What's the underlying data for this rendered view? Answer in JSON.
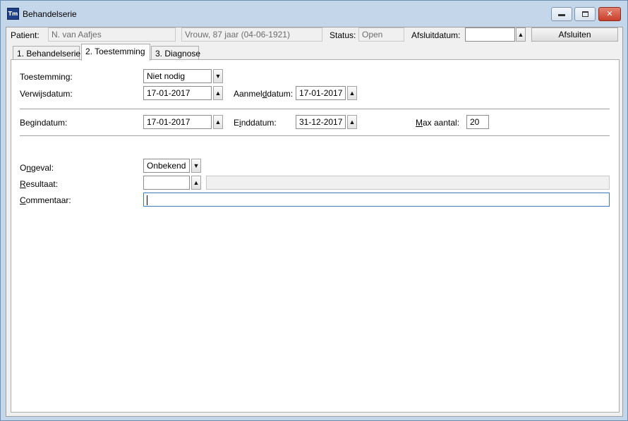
{
  "window": {
    "title": "Behandelserie",
    "app_icon_label": "Tm"
  },
  "header": {
    "patient_label": "Patient:",
    "patient_name": "N. van Aafjes",
    "patient_info": "Vrouw, 87 jaar (04-06-1921)",
    "status_label": "Status:",
    "status_value": "Open",
    "afsluitdatum_label": "Afsluitdatum:",
    "afsluitdatum_value": "",
    "afsluiten_button": "Afsluiten"
  },
  "tabs": [
    {
      "label": "1. Behandelserie",
      "active": false
    },
    {
      "label": "2. Toestemming",
      "active": true
    },
    {
      "label": "3. Diagnose",
      "active": false
    }
  ],
  "form": {
    "toestemming_label": "Toestemming:",
    "toestemming_value": "Niet nodig",
    "verwijsdatum_label": "Verwijsdatum:",
    "verwijsdatum_value": "17-01-2017",
    "aanmelddatum_label_pre": "Aanmel",
    "aanmelddatum_label_ul": "d",
    "aanmelddatum_label_post": "datum:",
    "aanmelddatum_value": "17-01-2017",
    "begindatum_label": "Begindatum:",
    "begindatum_value": "17-01-2017",
    "einddatum_label_pre": "E",
    "einddatum_label_ul": "i",
    "einddatum_label_post": "nddatum:",
    "einddatum_value": "31-12-2017",
    "max_aantal_label_ul": "M",
    "max_aantal_label_post": "ax aantal:",
    "max_aantal_value": "20",
    "ongeval_label_pre": "O",
    "ongeval_label_ul": "n",
    "ongeval_label_post": "geval:",
    "ongeval_value": "Onbekend",
    "resultaat_label_ul": "R",
    "resultaat_label_post": "esultaat:",
    "resultaat_value": "",
    "resultaat_desc": "",
    "commentaar_label_ul": "C",
    "commentaar_label_post": "ommentaar:",
    "commentaar_value": ""
  },
  "icons": {
    "dropdown_arrow": "down-arrow-icon",
    "date_picker_arrow": "up-arrow-icon"
  }
}
